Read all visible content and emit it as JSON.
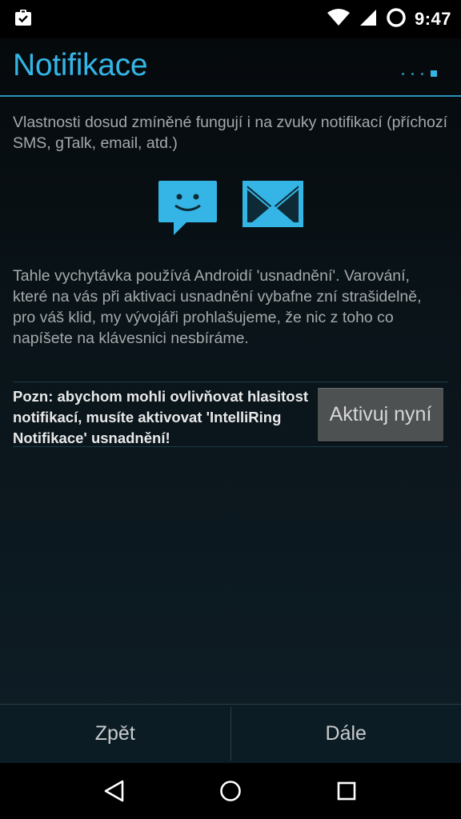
{
  "status_bar": {
    "time": "9:47",
    "icons": [
      "clipboard-check-icon",
      "wifi-icon",
      "signal-icon",
      "circle-notification-icon"
    ]
  },
  "header": {
    "title": "Notifikace",
    "pager": {
      "pages": 4,
      "current": 4
    }
  },
  "content": {
    "paragraph1": "Vlastnosti dosud zmíněné fungují i na zvuky notifikací (příchozí SMS, gTalk, email, atd.)",
    "icons": [
      "sms-chat-icon",
      "email-icon"
    ],
    "paragraph2": "Tahle vychytávka používá Androidí 'usnadnění'. Varování, které na vás při aktivaci usnadnění vybafne zní strašidelně, pro váš klid, my vývojáři prohlašujeme, že nic z toho co napíšete na klávesnici nesbíráme.",
    "note": "Pozn: abychom mohli ovlivňovat hlasitost notifikací, musíte aktivovat 'IntelliRing Notifikace' usnadnění!",
    "activate_button": "Aktivuj nyní"
  },
  "bottom_bar": {
    "back_label": "Zpět",
    "next_label": "Dále"
  },
  "nav_bar": {
    "icons": [
      "back-icon",
      "home-icon",
      "recents-icon"
    ]
  },
  "colors": {
    "accent": "#35b5e5",
    "text": "#a5a9ab",
    "button_bg": "#4d5152"
  }
}
